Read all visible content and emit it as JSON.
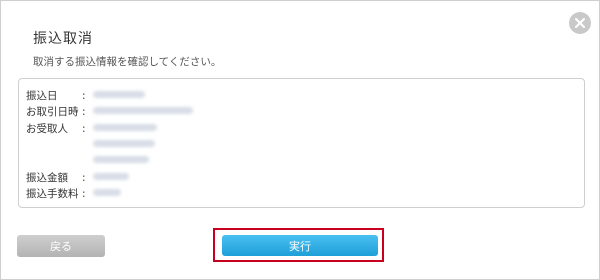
{
  "dialog": {
    "title": "振込取消",
    "subtitle": "取消する振込情報を確認してください。",
    "close_icon": "close-icon"
  },
  "details": {
    "rows": [
      {
        "label": "振込日",
        "colon": ":"
      },
      {
        "label": "お取引日時",
        "colon": ":"
      },
      {
        "label": "お受取人",
        "colon": ":"
      },
      {
        "label": "振込金額",
        "colon": ":"
      },
      {
        "label": "振込手数料",
        "colon": ":"
      }
    ]
  },
  "buttons": {
    "back_label": "戻る",
    "execute_label": "実行"
  },
  "colors": {
    "execute_button": "#1e9fd8",
    "highlight_frame": "#c8001e",
    "back_button": "#b3b3b3"
  }
}
